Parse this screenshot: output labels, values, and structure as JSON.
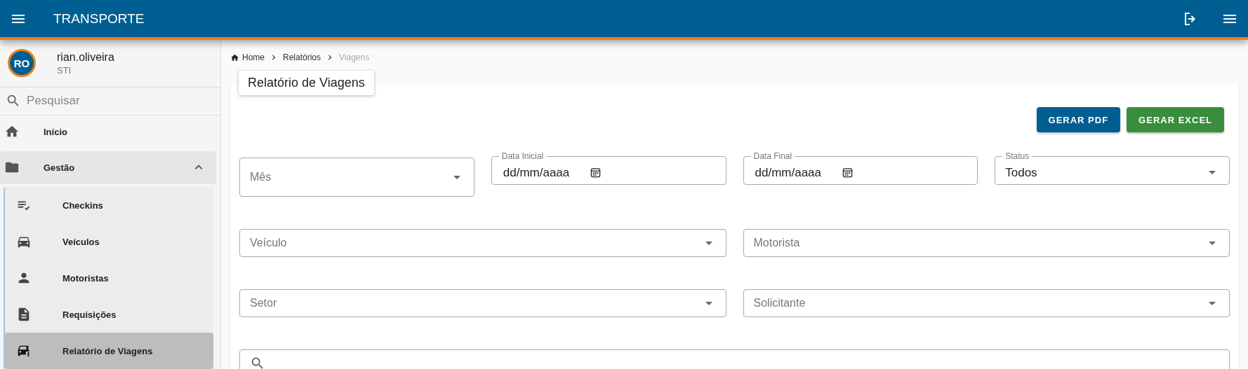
{
  "header": {
    "title": "TRANSPORTE"
  },
  "user": {
    "initials": "RO",
    "name": "rian.oliveira",
    "department": "STI"
  },
  "sidebar": {
    "search": {
      "placeholder": "Pesquisar"
    },
    "items": [
      {
        "label": "Início",
        "selected": false
      },
      {
        "label": "Gestão",
        "selected": false,
        "expanded": true,
        "children": [
          {
            "label": "Checkins",
            "selected": false
          },
          {
            "label": "Veículos",
            "selected": false
          },
          {
            "label": "Motoristas",
            "selected": false
          },
          {
            "label": "Requisições",
            "selected": false
          },
          {
            "label": "Relatório de Viagens",
            "selected": true
          }
        ]
      }
    ]
  },
  "breadcrumbs": [
    {
      "label": "Home",
      "current": false
    },
    {
      "label": "Relatórios",
      "current": false
    },
    {
      "label": "Viagens",
      "current": true
    }
  ],
  "panel": {
    "title": "Relatório de Viagens",
    "buttons": [
      {
        "label": "GERAR PDF",
        "kind": "pdf"
      },
      {
        "label": "GERAR EXCEL",
        "kind": "excel"
      }
    ],
    "filter_rows": [
      [
        {
          "kind": "select",
          "placeholder": "Mês"
        },
        {
          "kind": "date",
          "label": "Data Inicial",
          "placeholder": "dd/mm/aaaa"
        },
        {
          "kind": "date",
          "label": "Data Final",
          "placeholder": "dd/mm/aaaa"
        },
        {
          "kind": "select",
          "label": "Status",
          "value": "Todos"
        }
      ],
      [
        {
          "kind": "select",
          "placeholder": "Veículo"
        },
        {
          "kind": "select",
          "placeholder": "Motorista"
        }
      ],
      [
        {
          "kind": "select",
          "placeholder": "Setor"
        },
        {
          "kind": "select",
          "placeholder": "Solicitante"
        }
      ],
      [
        {
          "kind": "search"
        }
      ]
    ]
  }
}
